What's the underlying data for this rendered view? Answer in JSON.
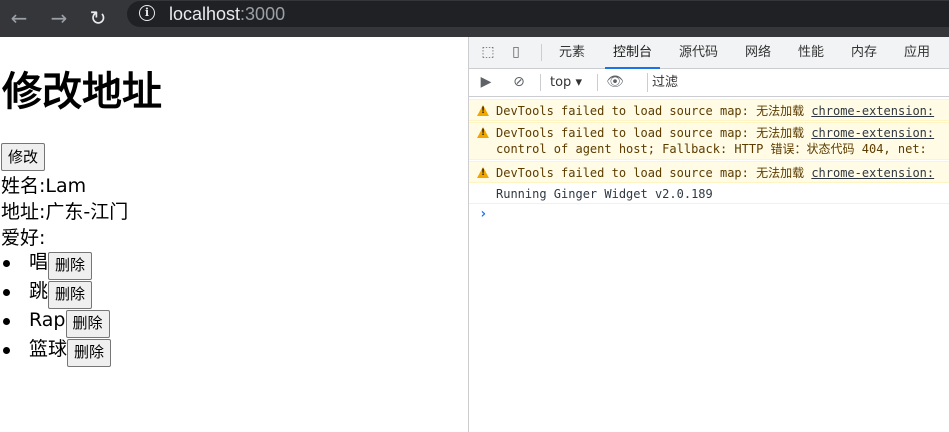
{
  "browser": {
    "url_host": "localhost",
    "url_port": ":3000"
  },
  "page": {
    "title": "修改地址",
    "edit_button": "修改",
    "name_line": "姓名:Lam",
    "address_line": "地址:广东-江门",
    "hobbies_label": "爱好:",
    "hobbies": [
      {
        "text": "唱",
        "delete_label": "删除"
      },
      {
        "text": "跳",
        "delete_label": "删除"
      },
      {
        "text": "Rap",
        "delete_label": "删除"
      },
      {
        "text": "篮球",
        "delete_label": "删除"
      }
    ]
  },
  "devtools": {
    "tabs": [
      "元素",
      "控制台",
      "源代码",
      "网络",
      "性能",
      "内存",
      "应用"
    ],
    "active_tab": "控制台",
    "context": "top",
    "filter_placeholder": "过滤",
    "messages": [
      {
        "level": "warning",
        "text": "DevTools failed to load source map: 无法加载 ",
        "link": "chrome-extension:"
      },
      {
        "level": "warning",
        "text": "DevTools failed to load source map: 无法加载 ",
        "link": "chrome-extension:",
        "text2": "control of agent host; Fallback: HTTP 错误：状态代码 404, net:"
      },
      {
        "level": "warning",
        "text": "DevTools failed to load source map: 无法加载 ",
        "link": "chrome-extension:"
      },
      {
        "level": "info",
        "text": "Running Ginger Widget v2.0.189"
      }
    ],
    "colors": {
      "accent": "#1a73e8",
      "warning_bg": "#fffbe5",
      "warning_icon": "#f2a600"
    }
  }
}
